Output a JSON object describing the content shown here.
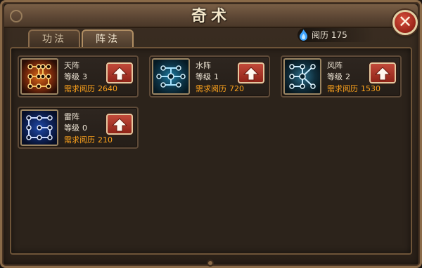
{
  "window": {
    "title": "奇术"
  },
  "tabs": [
    {
      "label": "功法",
      "active": false
    },
    {
      "label": "阵法",
      "active": true
    }
  ],
  "experience": {
    "icon": "blue-flame-icon",
    "label": "阅历",
    "value": "175"
  },
  "formations": [
    {
      "name": "天阵",
      "level_label": "等级",
      "level": "3",
      "req_label": "需求阅历",
      "req_value": "2640",
      "icon": "heaven-formation-icon",
      "theme": "fire"
    },
    {
      "name": "水阵",
      "level_label": "等级",
      "level": "1",
      "req_label": "需求阅历",
      "req_value": "720",
      "icon": "water-formation-icon",
      "theme": "water"
    },
    {
      "name": "风阵",
      "level_label": "等级",
      "level": "2",
      "req_label": "需求阅历",
      "req_value": "1530",
      "icon": "wind-formation-icon",
      "theme": "wind"
    },
    {
      "name": "雷阵",
      "level_label": "等级",
      "level": "0",
      "req_label": "需求阅历",
      "req_value": "210",
      "icon": "thunder-formation-icon",
      "theme": "thunder"
    }
  ],
  "colors": {
    "requirement_text": "#ffa31c",
    "upgrade_button": "#b03a2c",
    "close_button": "#c43d2e"
  }
}
